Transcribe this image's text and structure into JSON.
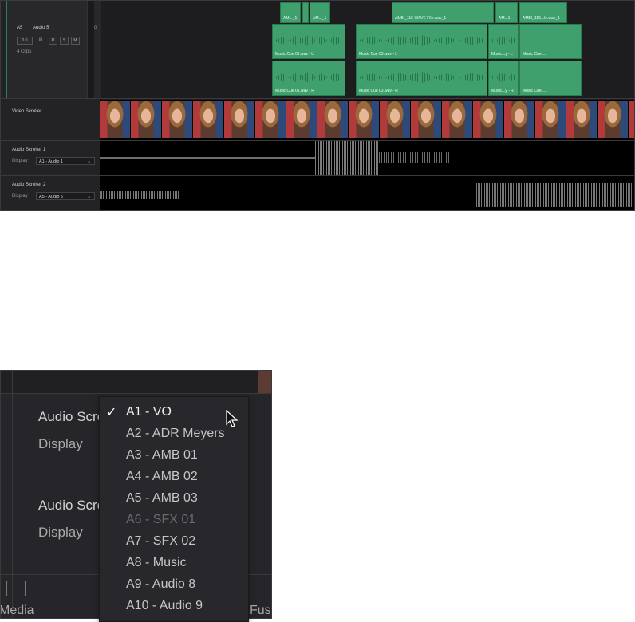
{
  "timeline": {
    "track": {
      "id": "A5",
      "name": "Audio 5",
      "channels": "2.0",
      "level": "0.0",
      "buttons": [
        "R",
        "S",
        "M"
      ],
      "clip_count": "4 Clips"
    },
    "top_clips": [
      "AM..._1",
      "AM..._1",
      "AMBI_115-WAVE File.wav_1",
      "AM...1",
      "AMBI_115...le.wav_1"
    ],
    "clips_L": [
      "Music Cue 01.wav - L",
      "Music Cue 03.wav - L",
      "Music...y - L",
      "Music Cue ..."
    ],
    "clips_R": [
      "Music Cue 01.wav - R",
      "Music Cue 03.wav - R",
      "Music...y - R",
      "Music Cue ..."
    ],
    "video_scroller_label": "Video Scroller",
    "audio_scroller_1": {
      "label": "Audio Scroller 1",
      "display_label": "Display",
      "value": "A1 - Audio 1"
    },
    "audio_scroller_2": {
      "label": "Audio Scroller 2",
      "display_label": "Display",
      "value": "A5 - Audio 5"
    }
  },
  "zoom": {
    "row1_label": "Audio Scro",
    "row1_display": "Display",
    "row2_label": "Audio Scro",
    "row2_display": "Display",
    "bottom_left_label": "Media",
    "bottom_right_label": "Fusi"
  },
  "dropdown": {
    "items": [
      {
        "label": "A1 - VO",
        "state": "checked"
      },
      {
        "label": "A2 - ADR Meyers",
        "state": "normal"
      },
      {
        "label": "A3 - AMB 01",
        "state": "normal"
      },
      {
        "label": "A4 - AMB 02",
        "state": "normal"
      },
      {
        "label": "A5 - AMB 03",
        "state": "normal"
      },
      {
        "label": "A6 - SFX 01",
        "state": "disabled"
      },
      {
        "label": "A7 - SFX 02",
        "state": "normal"
      },
      {
        "label": "A8 - Music",
        "state": "normal"
      },
      {
        "label": "A9 - Audio 8",
        "state": "normal"
      },
      {
        "label": "A10 - Audio 9",
        "state": "normal"
      }
    ]
  },
  "colors": {
    "clip_green": "#3fa06d",
    "playhead": "#c0392b"
  }
}
